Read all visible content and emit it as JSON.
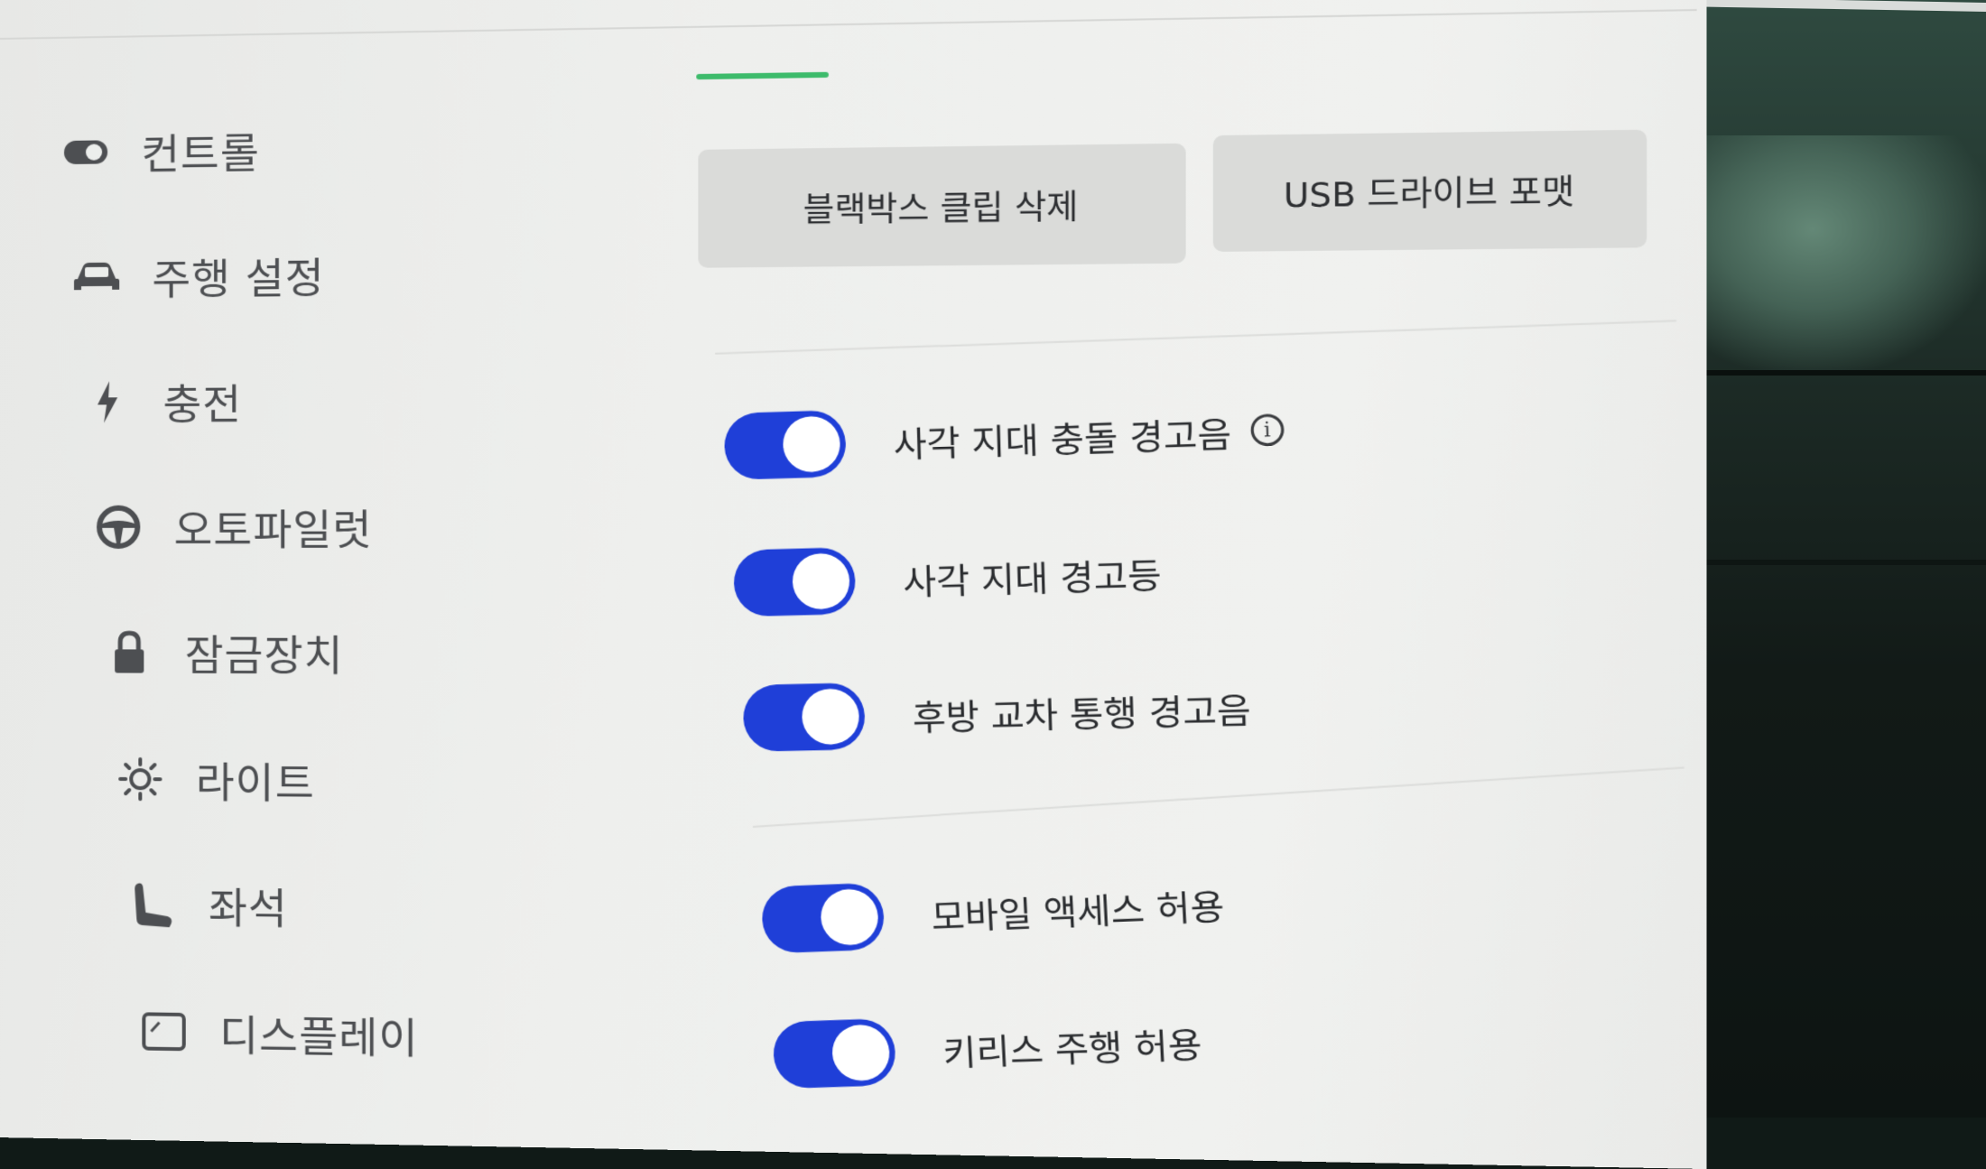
{
  "sidebar": {
    "items": [
      {
        "label": "컨트롤",
        "icon": "toggle-icon"
      },
      {
        "label": "주행 설정",
        "icon": "car-icon"
      },
      {
        "label": "충전",
        "icon": "lightning-icon"
      },
      {
        "label": "오토파일럿",
        "icon": "steering-wheel-icon"
      },
      {
        "label": "잠금장치",
        "icon": "lock-icon"
      },
      {
        "label": "라이트",
        "icon": "sun-icon"
      },
      {
        "label": "좌석",
        "icon": "seat-icon"
      },
      {
        "label": "디스플레이",
        "icon": "display-icon"
      }
    ]
  },
  "actions": {
    "delete_clips_label": "블랙박스 클립 삭제",
    "format_usb_label": "USB 드라이브 포맷"
  },
  "toggles": [
    {
      "label": "사각 지대 충돌 경고음",
      "on": true,
      "has_info": true
    },
    {
      "label": "사각 지대 경고등",
      "on": true
    },
    {
      "label": "후방 교차 통행 경고음",
      "on": true
    },
    {
      "label": "모바일 액세스 허용",
      "on": true
    },
    {
      "label": "키리스 주행 허용",
      "on": true
    }
  ],
  "colors": {
    "toggle_on": "#1f3fd8",
    "tab_indicator": "#3dbb6b",
    "background": "#eeefed"
  }
}
